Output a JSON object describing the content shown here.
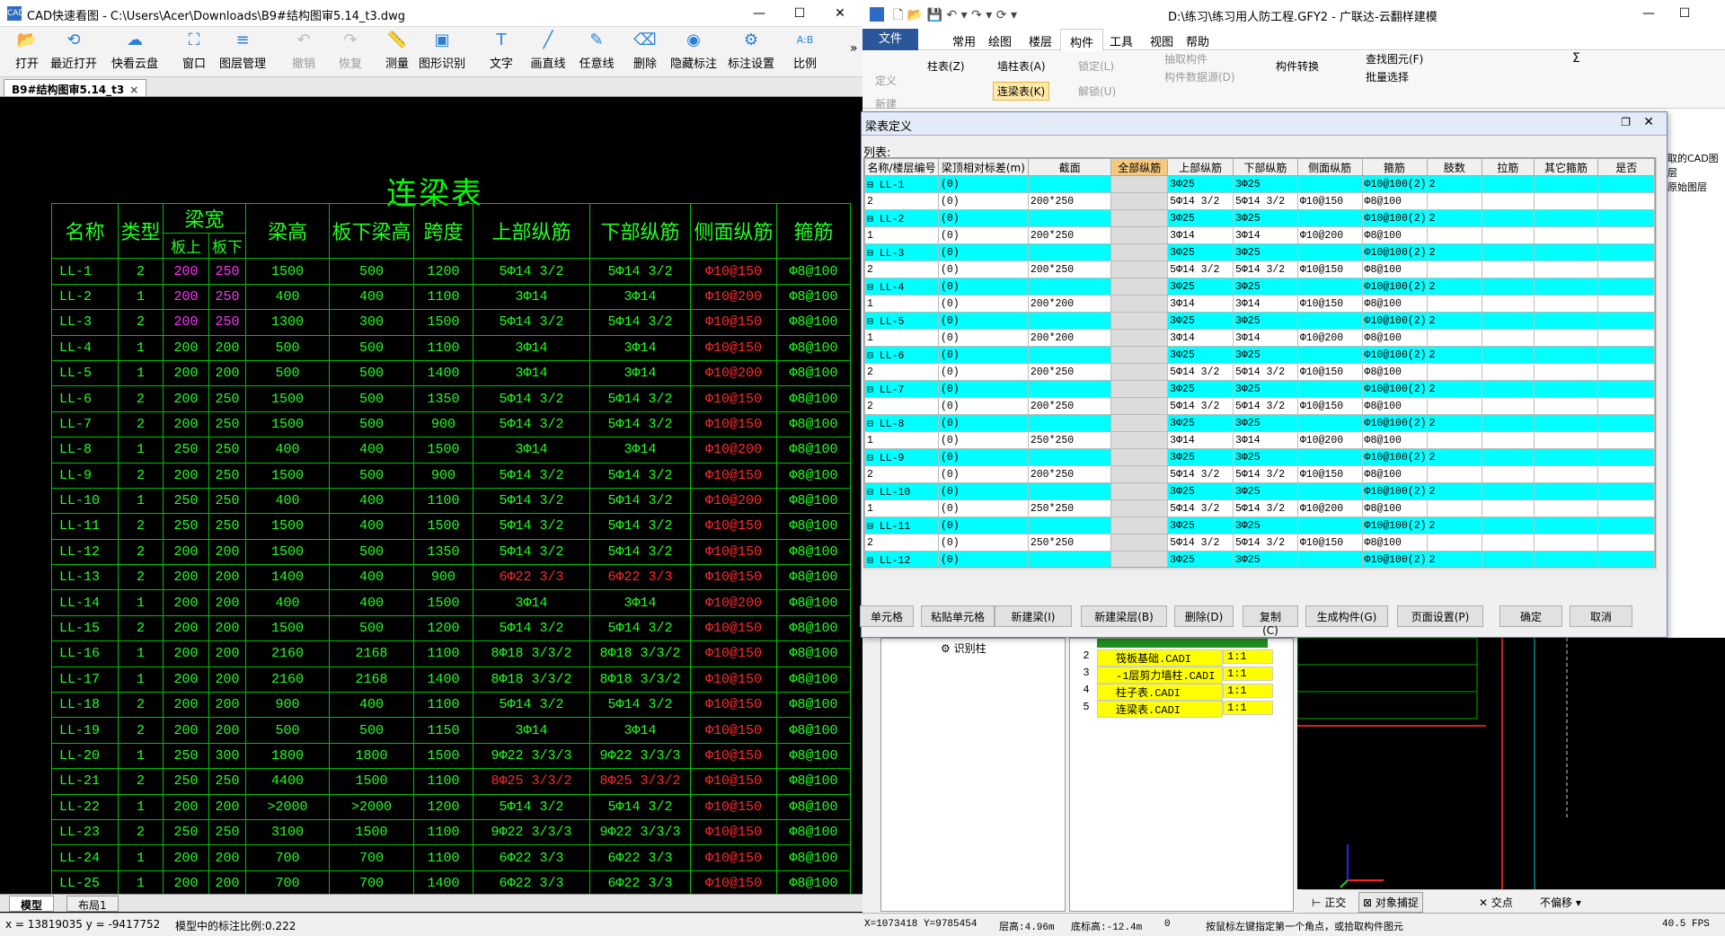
{
  "cad": {
    "title": "CAD快速看图 - C:\\Users\\Acer\\Downloads\\B9#结构图审5.14_t3.dwg",
    "toolbar": [
      {
        "label": "打开",
        "icon": "folder-open-icon",
        "glyph": "📂",
        "disabled": false
      },
      {
        "label": "最近打开",
        "icon": "history-icon",
        "glyph": "⟲",
        "disabled": false
      },
      {
        "label": "快看云盘",
        "icon": "cloud-icon",
        "glyph": "☁",
        "disabled": false
      },
      {
        "label": "窗口",
        "icon": "window-icon",
        "glyph": "⛶",
        "disabled": false
      },
      {
        "label": "图层管理",
        "icon": "layers-icon",
        "glyph": "≡",
        "disabled": false
      },
      {
        "label": "撤销",
        "icon": "undo-icon",
        "glyph": "↶",
        "disabled": true
      },
      {
        "label": "恢复",
        "icon": "redo-icon",
        "glyph": "↷",
        "disabled": true
      },
      {
        "label": "测量",
        "icon": "ruler-icon",
        "glyph": "📏",
        "disabled": false
      },
      {
        "label": "图形识别",
        "icon": "shape-recognize-icon",
        "glyph": "▣",
        "disabled": false
      },
      {
        "label": "文字",
        "icon": "text-icon",
        "glyph": "T",
        "disabled": false
      },
      {
        "label": "画直线",
        "icon": "line-icon",
        "glyph": "╱",
        "disabled": false
      },
      {
        "label": "任意线",
        "icon": "pen-icon",
        "glyph": "✎",
        "disabled": false
      },
      {
        "label": "删除",
        "icon": "eraser-icon",
        "glyph": "⌫",
        "disabled": false
      },
      {
        "label": "隐藏标注",
        "icon": "eye-hide-icon",
        "glyph": "◉",
        "disabled": false
      },
      {
        "label": "标注设置",
        "icon": "annotation-settings-icon",
        "glyph": "⚙",
        "disabled": false
      },
      {
        "label": "比例",
        "icon": "scale-icon",
        "glyph": "A:B",
        "disabled": false
      }
    ],
    "doc_tab": "B9#结构图审5.14_t3",
    "drawing_title": "连梁表",
    "table_headers": {
      "name": "名称",
      "type": "类型",
      "width_group": "梁宽",
      "width_top": "板上",
      "width_bottom": "板下",
      "height": "梁高",
      "under_slab": "板下梁高",
      "span": "跨度",
      "top_bars": "上部纵筋",
      "bottom_bars": "下部纵筋",
      "side_bars": "侧面纵筋",
      "stirrup": "箍筋"
    },
    "table_rows": [
      {
        "name": "LL-1",
        "type": "2",
        "w1": "200",
        "w2": "250",
        "h": "1500",
        "hs": "500",
        "span": "1200",
        "top": "5Φ14 3/2",
        "bot": "5Φ14 3/2",
        "side": "Φ10@150",
        "stir": "Φ8@100",
        "wcolor": "mag",
        "rcolor": ""
      },
      {
        "name": "LL-2",
        "type": "1",
        "w1": "200",
        "w2": "250",
        "h": "400",
        "hs": "400",
        "span": "1100",
        "top": "3Φ14",
        "bot": "3Φ14",
        "side": "Φ10@200",
        "stir": "Φ8@100",
        "wcolor": "mag",
        "rcolor": ""
      },
      {
        "name": "LL-3",
        "type": "2",
        "w1": "200",
        "w2": "250",
        "h": "1300",
        "hs": "300",
        "span": "1500",
        "top": "5Φ14 3/2",
        "bot": "5Φ14 3/2",
        "side": "Φ10@150",
        "stir": "Φ8@100",
        "wcolor": "mag",
        "rcolor": ""
      },
      {
        "name": "LL-4",
        "type": "1",
        "w1": "200",
        "w2": "200",
        "h": "500",
        "hs": "500",
        "span": "1100",
        "top": "3Φ14",
        "bot": "3Φ14",
        "side": "Φ10@150",
        "stir": "Φ8@100",
        "wcolor": "",
        "rcolor": ""
      },
      {
        "name": "LL-5",
        "type": "1",
        "w1": "200",
        "w2": "200",
        "h": "500",
        "hs": "500",
        "span": "1400",
        "top": "3Φ14",
        "bot": "3Φ14",
        "side": "Φ10@200",
        "stir": "Φ8@100",
        "wcolor": "",
        "rcolor": ""
      },
      {
        "name": "LL-6",
        "type": "2",
        "w1": "200",
        "w2": "250",
        "h": "1500",
        "hs": "500",
        "span": "1350",
        "top": "5Φ14 3/2",
        "bot": "5Φ14 3/2",
        "side": "Φ10@150",
        "stir": "Φ8@100",
        "wcolor": "",
        "rcolor": ""
      },
      {
        "name": "LL-7",
        "type": "2",
        "w1": "200",
        "w2": "250",
        "h": "1500",
        "hs": "500",
        "span": "900",
        "top": "5Φ14 3/2",
        "bot": "5Φ14 3/2",
        "side": "Φ10@150",
        "stir": "Φ8@100",
        "wcolor": "",
        "rcolor": ""
      },
      {
        "name": "LL-8",
        "type": "1",
        "w1": "250",
        "w2": "250",
        "h": "400",
        "hs": "400",
        "span": "1500",
        "top": "3Φ14",
        "bot": "3Φ14",
        "side": "Φ10@200",
        "stir": "Φ8@100",
        "wcolor": "",
        "rcolor": ""
      },
      {
        "name": "LL-9",
        "type": "2",
        "w1": "200",
        "w2": "250",
        "h": "1500",
        "hs": "500",
        "span": "900",
        "top": "5Φ14 3/2",
        "bot": "5Φ14 3/2",
        "side": "Φ10@150",
        "stir": "Φ8@100",
        "wcolor": "",
        "rcolor": ""
      },
      {
        "name": "LL-10",
        "type": "1",
        "w1": "250",
        "w2": "250",
        "h": "400",
        "hs": "400",
        "span": "1100",
        "top": "5Φ14 3/2",
        "bot": "5Φ14 3/2",
        "side": "Φ10@200",
        "stir": "Φ8@100",
        "wcolor": "",
        "rcolor": ""
      },
      {
        "name": "LL-11",
        "type": "2",
        "w1": "250",
        "w2": "250",
        "h": "1500",
        "hs": "400",
        "span": "1500",
        "top": "5Φ14 3/2",
        "bot": "5Φ14 3/2",
        "side": "Φ10@150",
        "stir": "Φ8@100",
        "wcolor": "",
        "rcolor": ""
      },
      {
        "name": "LL-12",
        "type": "2",
        "w1": "200",
        "w2": "200",
        "h": "1500",
        "hs": "500",
        "span": "1350",
        "top": "5Φ14 3/2",
        "bot": "5Φ14 3/2",
        "side": "Φ10@150",
        "stir": "Φ8@100",
        "wcolor": "",
        "rcolor": ""
      },
      {
        "name": "LL-13",
        "type": "2",
        "w1": "200",
        "w2": "200",
        "h": "1400",
        "hs": "400",
        "span": "900",
        "top": "6Φ22 3/3",
        "bot": "6Φ22 3/3",
        "side": "Φ10@150",
        "stir": "Φ8@100",
        "wcolor": "",
        "rcolor": "red"
      },
      {
        "name": "LL-14",
        "type": "1",
        "w1": "200",
        "w2": "200",
        "h": "400",
        "hs": "400",
        "span": "1500",
        "top": "3Φ14",
        "bot": "3Φ14",
        "side": "Φ10@200",
        "stir": "Φ8@100",
        "wcolor": "",
        "rcolor": ""
      },
      {
        "name": "LL-15",
        "type": "2",
        "w1": "200",
        "w2": "200",
        "h": "1500",
        "hs": "500",
        "span": "1200",
        "top": "5Φ14 3/2",
        "bot": "5Φ14 3/2",
        "side": "Φ10@150",
        "stir": "Φ8@100",
        "wcolor": "",
        "rcolor": ""
      },
      {
        "name": "LL-16",
        "type": "1",
        "w1": "200",
        "w2": "200",
        "h": "2160",
        "hs": "2168",
        "span": "1100",
        "top": "8Φ18 3/3/2",
        "bot": "8Φ18 3/3/2",
        "side": "Φ10@150",
        "stir": "Φ8@100",
        "wcolor": "",
        "rcolor": ""
      },
      {
        "name": "LL-17",
        "type": "1",
        "w1": "200",
        "w2": "200",
        "h": "2160",
        "hs": "2168",
        "span": "1400",
        "top": "8Φ18 3/3/2",
        "bot": "8Φ18 3/3/2",
        "side": "Φ10@150",
        "stir": "Φ8@100",
        "wcolor": "",
        "rcolor": ""
      },
      {
        "name": "LL-18",
        "type": "2",
        "w1": "200",
        "w2": "200",
        "h": "900",
        "hs": "400",
        "span": "1100",
        "top": "5Φ14 3/2",
        "bot": "5Φ14 3/2",
        "side": "Φ10@150",
        "stir": "Φ8@100",
        "wcolor": "",
        "rcolor": ""
      },
      {
        "name": "LL-19",
        "type": "2",
        "w1": "200",
        "w2": "200",
        "h": "500",
        "hs": "500",
        "span": "1150",
        "top": "3Φ14",
        "bot": "3Φ14",
        "side": "Φ10@150",
        "stir": "Φ8@100",
        "wcolor": "",
        "rcolor": ""
      },
      {
        "name": "LL-20",
        "type": "1",
        "w1": "250",
        "w2": "300",
        "h": "1800",
        "hs": "1800",
        "span": "1500",
        "top": "9Φ22 3/3/3",
        "bot": "9Φ22 3/3/3",
        "side": "Φ10@150",
        "stir": "Φ8@100",
        "wcolor": "",
        "rcolor": ""
      },
      {
        "name": "LL-21",
        "type": "2",
        "w1": "250",
        "w2": "250",
        "h": "4400",
        "hs": "1500",
        "span": "1100",
        "top": "8Φ25 3/3/2",
        "bot": "8Φ25 3/3/2",
        "side": "Φ10@150",
        "stir": "Φ8@100",
        "wcolor": "",
        "rcolor": "red"
      },
      {
        "name": "LL-22",
        "type": "1",
        "w1": "200",
        "w2": "200",
        "h": ">2000",
        "hs": ">2000",
        "span": "1200",
        "top": "5Φ14 3/2",
        "bot": "5Φ14 3/2",
        "side": "Φ10@150",
        "stir": "Φ8@100",
        "wcolor": "",
        "rcolor": ""
      },
      {
        "name": "LL-23",
        "type": "2",
        "w1": "250",
        "w2": "250",
        "h": "3100",
        "hs": "1500",
        "span": "1100",
        "top": "9Φ22 3/3/3",
        "bot": "9Φ22 3/3/3",
        "side": "Φ10@150",
        "stir": "Φ8@100",
        "wcolor": "",
        "rcolor": ""
      },
      {
        "name": "LL-24",
        "type": "1",
        "w1": "200",
        "w2": "200",
        "h": "700",
        "hs": "700",
        "span": "1100",
        "top": "6Φ22 3/3",
        "bot": "6Φ22 3/3",
        "side": "Φ10@150",
        "stir": "Φ8@100",
        "wcolor": "",
        "rcolor": ""
      },
      {
        "name": "LL-25",
        "type": "1",
        "w1": "200",
        "w2": "200",
        "h": "700",
        "hs": "700",
        "span": "1400",
        "top": "6Φ22 3/3",
        "bot": "6Φ22 3/3",
        "side": "Φ10@150",
        "stir": "Φ8@100",
        "wcolor": "",
        "rcolor": ""
      }
    ],
    "bottom_tabs": {
      "model": "模型",
      "layout": "布局1"
    },
    "status": {
      "coords": "x = 13819035  y = -9417752",
      "scale": "模型中的标注比例:0.222"
    }
  },
  "gld": {
    "title": "D:\\练习\\练习用人防工程.GFY2 - 广联达-云翻样建模",
    "menu": [
      "文件",
      "常用",
      "绘图",
      "楼层",
      "构件",
      "工具",
      "视图",
      "帮助"
    ],
    "active_menu": "构件",
    "ribbon": {
      "define": "定义",
      "column_table": "柱表(Z)",
      "wall_column_table": "墙柱表(A)",
      "lock": "锁定(L)",
      "pick": "抽取构件",
      "data_source": "构件数据源(D)",
      "convert": "构件转换",
      "find": "查找图元(F)",
      "batch_select": "批量选择",
      "new": "新建",
      "unlock": "解锁(U)",
      "beam_table": "连梁表(K)",
      "sigma": "Σ"
    },
    "dialog": {
      "title": "梁表定义",
      "list_label": "列表:",
      "headers": [
        "名称/楼层编号",
        "梁顶相对标差(m)",
        "截面",
        "全部纵筋",
        "上部纵筋",
        "下部纵筋",
        "侧面纵筋",
        "箍筋",
        "肢数",
        "拉筋",
        "其它箍筋",
        "是否"
      ],
      "rows": [
        {
          "k": "cy",
          "c": [
            "⊟ LL-1",
            "(0)",
            "",
            "",
            "3Φ25",
            "3Φ25",
            "",
            "Φ10@100(2)",
            "2",
            "",
            "",
            ""
          ]
        },
        {
          "k": "wt",
          "c": [
            "   2",
            "(0)",
            "200*250",
            "",
            "5Φ14 3/2",
            "5Φ14 3/2",
            "Φ10@150",
            "Φ8@100",
            "",
            "",
            "",
            ""
          ]
        },
        {
          "k": "cy",
          "c": [
            "⊟ LL-2",
            "(0)",
            "",
            "",
            "3Φ25",
            "3Φ25",
            "",
            "Φ10@100(2)",
            "2",
            "",
            "",
            ""
          ]
        },
        {
          "k": "wt",
          "c": [
            "   1",
            "(0)",
            "200*250",
            "",
            "3Φ14",
            "3Φ14",
            "Φ10@200",
            "Φ8@100",
            "",
            "",
            "",
            ""
          ]
        },
        {
          "k": "cy",
          "c": [
            "⊟ LL-3",
            "(0)",
            "",
            "",
            "3Φ25",
            "3Φ25",
            "",
            "Φ10@100(2)",
            "2",
            "",
            "",
            ""
          ]
        },
        {
          "k": "wt",
          "c": [
            "   2",
            "(0)",
            "200*250",
            "",
            "5Φ14 3/2",
            "5Φ14 3/2",
            "Φ10@150",
            "Φ8@100",
            "",
            "",
            "",
            ""
          ]
        },
        {
          "k": "cy",
          "c": [
            "⊟ LL-4",
            "(0)",
            "",
            "",
            "3Φ25",
            "3Φ25",
            "",
            "Φ10@100(2)",
            "2",
            "",
            "",
            ""
          ]
        },
        {
          "k": "wt",
          "c": [
            "   1",
            "(0)",
            "200*200",
            "",
            "3Φ14",
            "3Φ14",
            "Φ10@150",
            "Φ8@100",
            "",
            "",
            "",
            ""
          ]
        },
        {
          "k": "cy",
          "c": [
            "⊟ LL-5",
            "(0)",
            "",
            "",
            "3Φ25",
            "3Φ25",
            "",
            "Φ10@100(2)",
            "2",
            "",
            "",
            ""
          ]
        },
        {
          "k": "wt",
          "c": [
            "   1",
            "(0)",
            "200*200",
            "",
            "3Φ14",
            "3Φ14",
            "Φ10@200",
            "Φ8@100",
            "",
            "",
            "",
            ""
          ]
        },
        {
          "k": "cy",
          "c": [
            "⊟ LL-6",
            "(0)",
            "",
            "",
            "3Φ25",
            "3Φ25",
            "",
            "Φ10@100(2)",
            "2",
            "",
            "",
            ""
          ]
        },
        {
          "k": "wt",
          "c": [
            "   2",
            "(0)",
            "200*250",
            "",
            "5Φ14 3/2",
            "5Φ14 3/2",
            "Φ10@150",
            "Φ8@100",
            "",
            "",
            "",
            ""
          ]
        },
        {
          "k": "cy",
          "c": [
            "⊟ LL-7",
            "(0)",
            "",
            "",
            "3Φ25",
            "3Φ25",
            "",
            "Φ10@100(2)",
            "2",
            "",
            "",
            ""
          ]
        },
        {
          "k": "wt",
          "c": [
            "   2",
            "(0)",
            "200*250",
            "",
            "5Φ14 3/2",
            "5Φ14 3/2",
            "Φ10@150",
            "Φ8@100",
            "",
            "",
            "",
            ""
          ]
        },
        {
          "k": "cy",
          "c": [
            "⊟ LL-8",
            "(0)",
            "",
            "",
            "3Φ25",
            "3Φ25",
            "",
            "Φ10@100(2)",
            "2",
            "",
            "",
            ""
          ]
        },
        {
          "k": "wt",
          "c": [
            "   1",
            "(0)",
            "250*250",
            "",
            "3Φ14",
            "3Φ14",
            "Φ10@200",
            "Φ8@100",
            "",
            "",
            "",
            ""
          ]
        },
        {
          "k": "cy",
          "c": [
            "⊟ LL-9",
            "(0)",
            "",
            "",
            "3Φ25",
            "3Φ25",
            "",
            "Φ10@100(2)",
            "2",
            "",
            "",
            ""
          ]
        },
        {
          "k": "wt",
          "c": [
            "   2",
            "(0)",
            "200*250",
            "",
            "5Φ14 3/2",
            "5Φ14 3/2",
            "Φ10@150",
            "Φ8@100",
            "",
            "",
            "",
            ""
          ]
        },
        {
          "k": "cy",
          "c": [
            "⊟ LL-10",
            "(0)",
            "",
            "",
            "3Φ25",
            "3Φ25",
            "",
            "Φ10@100(2)",
            "2",
            "",
            "",
            ""
          ]
        },
        {
          "k": "wt",
          "c": [
            "   1",
            "(0)",
            "250*250",
            "",
            "5Φ14 3/2",
            "5Φ14 3/2",
            "Φ10@200",
            "Φ8@100",
            "",
            "",
            "",
            ""
          ]
        },
        {
          "k": "cy",
          "c": [
            "⊟ LL-11",
            "(0)",
            "",
            "",
            "3Φ25",
            "3Φ25",
            "",
            "Φ10@100(2)",
            "2",
            "",
            "",
            ""
          ]
        },
        {
          "k": "wt",
          "c": [
            "   2",
            "(0)",
            "250*250",
            "",
            "5Φ14 3/2",
            "5Φ14 3/2",
            "Φ10@150",
            "Φ8@100",
            "",
            "",
            "",
            ""
          ]
        },
        {
          "k": "cy",
          "c": [
            "⊟ LL-12",
            "(0)",
            "",
            "",
            "3Φ25",
            "3Φ25",
            "",
            "Φ10@100(2)",
            "2",
            "",
            "",
            ""
          ]
        }
      ],
      "buttons": [
        "单元格",
        "粘贴单元格",
        "新建梁(I)",
        "新建梁层(B)",
        "删除(D)",
        "复制(C)",
        "生成构件(G)",
        "页面设置(P)",
        "确定",
        "取消"
      ]
    },
    "tree_item": "识别柱",
    "files": [
      {
        "n": "2",
        "name": "筏板基础.CADI",
        "scale": "1:1"
      },
      {
        "n": "3",
        "name": "-1层剪力墙柱.CADI",
        "scale": "1:1"
      },
      {
        "n": "4",
        "name": "柱子表.CADI",
        "scale": "1:1"
      },
      {
        "n": "5",
        "name": "连梁表.CADI",
        "scale": "1:1"
      }
    ],
    "side_snippet": [
      "取的CAD图层",
      "原始图层"
    ],
    "snap_bar": {
      "ortho": "正交",
      "snap": "对象捕捉",
      "intersect": "交点",
      "offset": "不偏移"
    },
    "status": {
      "coords": "X=1073418 Y=9785454",
      "floor_h": "层高:4.96m",
      "bottom_h": "底标高:-12.4m",
      "zero": "0",
      "prompt": "按鼠标左键指定第一个角点，或拾取构件图元",
      "fps": "40.5 FPS"
    }
  }
}
